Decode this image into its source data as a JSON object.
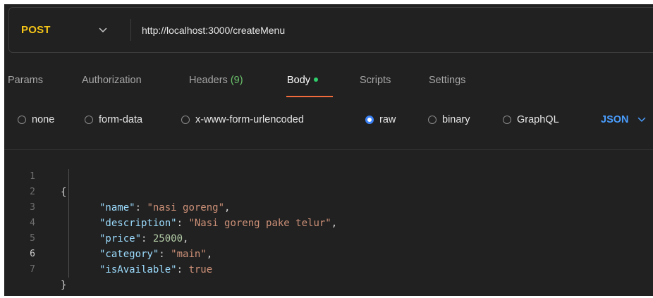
{
  "request": {
    "method": "POST",
    "url": "http://localhost:3000/createMenu"
  },
  "tabs": {
    "params": "Params",
    "authorization": "Authorization",
    "headers": "Headers",
    "headers_count": "(9)",
    "body": "Body",
    "scripts": "Scripts",
    "settings": "Settings",
    "active": "Body"
  },
  "body_options": {
    "none": "none",
    "form_data": "form-data",
    "urlencoded": "x-www-form-urlencoded",
    "raw": "raw",
    "binary": "binary",
    "graphql": "GraphQL",
    "selected": "raw",
    "content_type": "JSON"
  },
  "editor": {
    "line_numbers": [
      "1",
      "2",
      "3",
      "4",
      "5",
      "6",
      "7"
    ],
    "current_line": "6",
    "open_brace": "{",
    "close_brace": "}",
    "fields": [
      {
        "key": "\"name\"",
        "value": "\"nasi goreng\"",
        "type": "string",
        "comma": ","
      },
      {
        "key": "\"description\"",
        "value": "\"Nasi goreng pake telur\"",
        "type": "string",
        "comma": ","
      },
      {
        "key": "\"price\"",
        "value": "25000",
        "type": "number",
        "comma": ","
      },
      {
        "key": "\"category\"",
        "value": "\"main\"",
        "type": "string",
        "comma": ","
      },
      {
        "key": "\"isAvailable\"",
        "value": "true",
        "type": "boolean",
        "comma": ""
      }
    ],
    "colon": ": "
  },
  "colors": {
    "method": "#f5c518",
    "accent_tab": "#f26b3a",
    "body_dot": "#2fcf6c",
    "headers_count": "#6bc26b",
    "json_type": "#4a9eff",
    "radio_checked": "#3b82f6",
    "json_key": "#9cdcfe",
    "json_string": "#ce9178",
    "json_number": "#b5cea8"
  },
  "icons": {
    "method_dropdown": "chevron-down-icon",
    "json_dropdown": "chevron-down-icon"
  }
}
